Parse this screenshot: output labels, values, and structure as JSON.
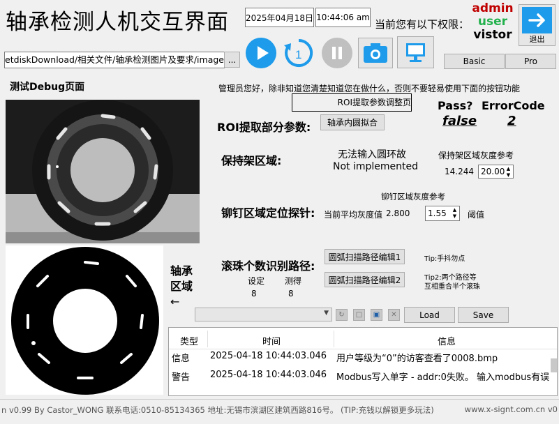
{
  "app": {
    "title": "轴承检测人机交互界面",
    "date": "2025年04月18日",
    "time": "10:44:06 am",
    "permissions_label": "当前您有以下权限：",
    "roles": [
      {
        "label": "admin",
        "color": "#c00000"
      },
      {
        "label": "user",
        "color": "#22b14c"
      },
      {
        "label": "vistor",
        "color": "#000000"
      }
    ],
    "exit_label": "退出"
  },
  "toolbar": {
    "path_value": "NetdiskDownload/相关文件/轴承检测图片及要求/image",
    "browse_label": "...",
    "basic_label": "Basic",
    "pro_label": "Pro",
    "icons": [
      "play-icon",
      "replay-icon",
      "pause-icon",
      "camera-icon",
      "monitor-icon"
    ]
  },
  "debug": {
    "page_title": "测试Debug页面",
    "admin_notice": "管理员您好，除非知道您清楚知道您在做什么，否则不要轻易使用下面的按钮功能",
    "roi_adjust_value": "ROI提取参数调整页",
    "pass_label": "Pass?",
    "pass_value": "false",
    "error_label": "ErrorCode",
    "error_value": "2",
    "roi_section": "ROI提取部分参数:",
    "inner_circle_btn": "轴承内圆拟合",
    "cage_section": "保持架区域:",
    "cage_cn": "无法输入圆环故",
    "cage_en": "Not implemented",
    "cage_gray_label": "保持架区域灰度参考",
    "cage_gray_value": "14.244",
    "cage_gray_spin": "20.00",
    "rivet_gray_label": "铆钉区域灰度参考",
    "rivet_section": "铆钉区域定位探针:",
    "avg_gray_label": "当前平均灰度值",
    "avg_gray_value": "2.800",
    "threshold_spin": "1.55",
    "threshold_label": "阈值",
    "ball_section": "滚珠个数识别路径:",
    "set_label": "设定",
    "measured_label": "测得",
    "set_value": "8",
    "measured_value": "8",
    "arc_btn1": "圆弧扫描路径编辑1",
    "arc_btn2": "圆弧扫描路径编辑2",
    "tip1": "Tip:手抖勿点",
    "tip2_line1": "Tip2:两个路径等",
    "tip2_line2": "互相重合半个滚珠",
    "bearing_label_1": "轴承",
    "bearing_label_2": "区域",
    "bearing_arrow": "←",
    "load_label": "Load",
    "save_label": "Save"
  },
  "log": {
    "headers": [
      "类型",
      "时间",
      "信息"
    ],
    "rows": [
      [
        "信息",
        "2025-04-18 10:44:03.046",
        "用户等级为“0”的访客查看了0008.bmp"
      ],
      [
        "警告",
        "2025-04-18 10:44:03.046",
        "Modbus写入单字 - addr:0失败。 输入modbus有误"
      ]
    ]
  },
  "status": {
    "left": "n v0.99 By Castor_WONG 联系电话:0510-85134365    地址:无锡市滨湖区建筑西路816号。    (TIP:充钱以解锁更多玩法)",
    "right": "www.x-signt.com.cn v0"
  }
}
